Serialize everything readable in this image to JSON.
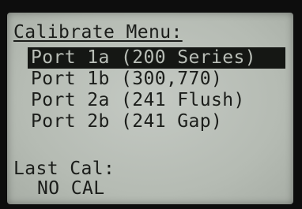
{
  "menu": {
    "title": "Calibrate Menu:",
    "items": [
      {
        "label": "Port 1a (200 Series)",
        "selected": true
      },
      {
        "label": "Port 1b (300,770)",
        "selected": false
      },
      {
        "label": "Port 2a (241 Flush)",
        "selected": false
      },
      {
        "label": "Port 2b (241 Gap)",
        "selected": false
      }
    ]
  },
  "last_cal": {
    "label": "Last Cal:",
    "value": "NO CAL"
  },
  "colors": {
    "lcd_background": "#b9beb7",
    "lcd_text": "#1b1d1a",
    "bezel": "#0d0d0d"
  }
}
